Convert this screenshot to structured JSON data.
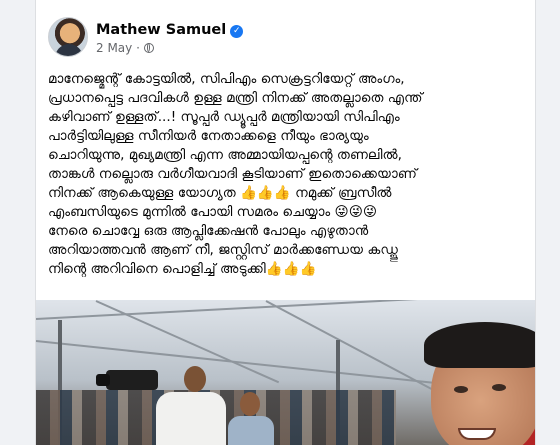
{
  "post": {
    "author": "Mathew Samuel",
    "verified_badge": "✓",
    "date": "2 May",
    "separator": "·",
    "privacy_icon": "globe-icon",
    "text_lines": [
      "മാനേജ്മെന്റ് കോട്ടയിൽ, സിപിഎം സെക്രട്ടറിയേറ്റ് അംഗം,",
      "പ്രധാനപ്പെട്ട പദവികൾ ഉള്ള മന്ത്രി നിനക്ക് അതല്ലാതെ എന്ത്",
      "കഴിവാണ് ഉള്ളത്...! സൂപ്പർ ഡ്യൂപ്പർ മന്ത്രിയായി സിപിഎം",
      "പാർട്ടിയിലുള്ള സീനിയർ നേതാക്കളെ നീയും ഭാര്യയും",
      "ചൊറിയുന്നു, മുഖ്യമന്ത്രി എന്ന അമ്മായിയപ്പന്റെ തണലിൽ,",
      "താങ്കൾ നല്ലൊരു വർഗീയവാദി കൂടിയാണ് ഇതൊക്കെയാണ്",
      "നിനക്ക് ആകെയുള്ള യോഗ്യത 👍👍👍 നമുക്ക് ബ്രസീൽ",
      "എംബസിയുടെ മുന്നിൽ പോയി സമരം ചെയ്യാം 😜😜😜",
      " നേരെ ചൊവ്വേ ഒരു ആപ്ലിക്കേഷൻ പോലും എഴുതാൻ",
      "അറിയാത്തവൻ ആണ് നീ, ജസ്റ്റിസ് മാർക്കണ്ഡേയ കഡ്ജു",
      "നിന്റെ അറിവിനെ പൊളിച്ച് അടുക്കി👍👍👍"
    ]
  },
  "colors": {
    "page_bg": "#f0f2f5",
    "card_bg": "#ffffff",
    "text": "#050505",
    "secondary_text": "#65676b",
    "verified_blue": "#1877f2"
  }
}
